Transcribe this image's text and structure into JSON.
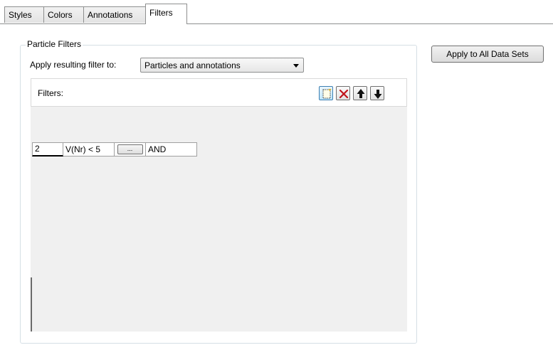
{
  "tabs": [
    {
      "label": "Styles",
      "active": false
    },
    {
      "label": "Colors",
      "active": false
    },
    {
      "label": "Annotations",
      "active": false
    },
    {
      "label": "Filters",
      "active": true
    }
  ],
  "apply_all_button": "Apply to All Data Sets",
  "particle_filters": {
    "legend": "Particle Filters",
    "apply_label": "Apply resulting filter to:",
    "apply_value": "Particles and annotations",
    "filters_label": "Filters:",
    "toolbar": {
      "icons": [
        "new-filter-icon",
        "delete-x-icon",
        "move-up-arrow-icon",
        "move-down-arrow-icon"
      ],
      "delete_color": "#c0141c"
    },
    "rows": [
      {
        "index": "2",
        "expression": "V(Nr) < 5",
        "button": "...",
        "operator": "AND"
      }
    ]
  },
  "colors": {
    "accent": "#3c7fb1",
    "panel_bg": "#f0f0f0"
  }
}
